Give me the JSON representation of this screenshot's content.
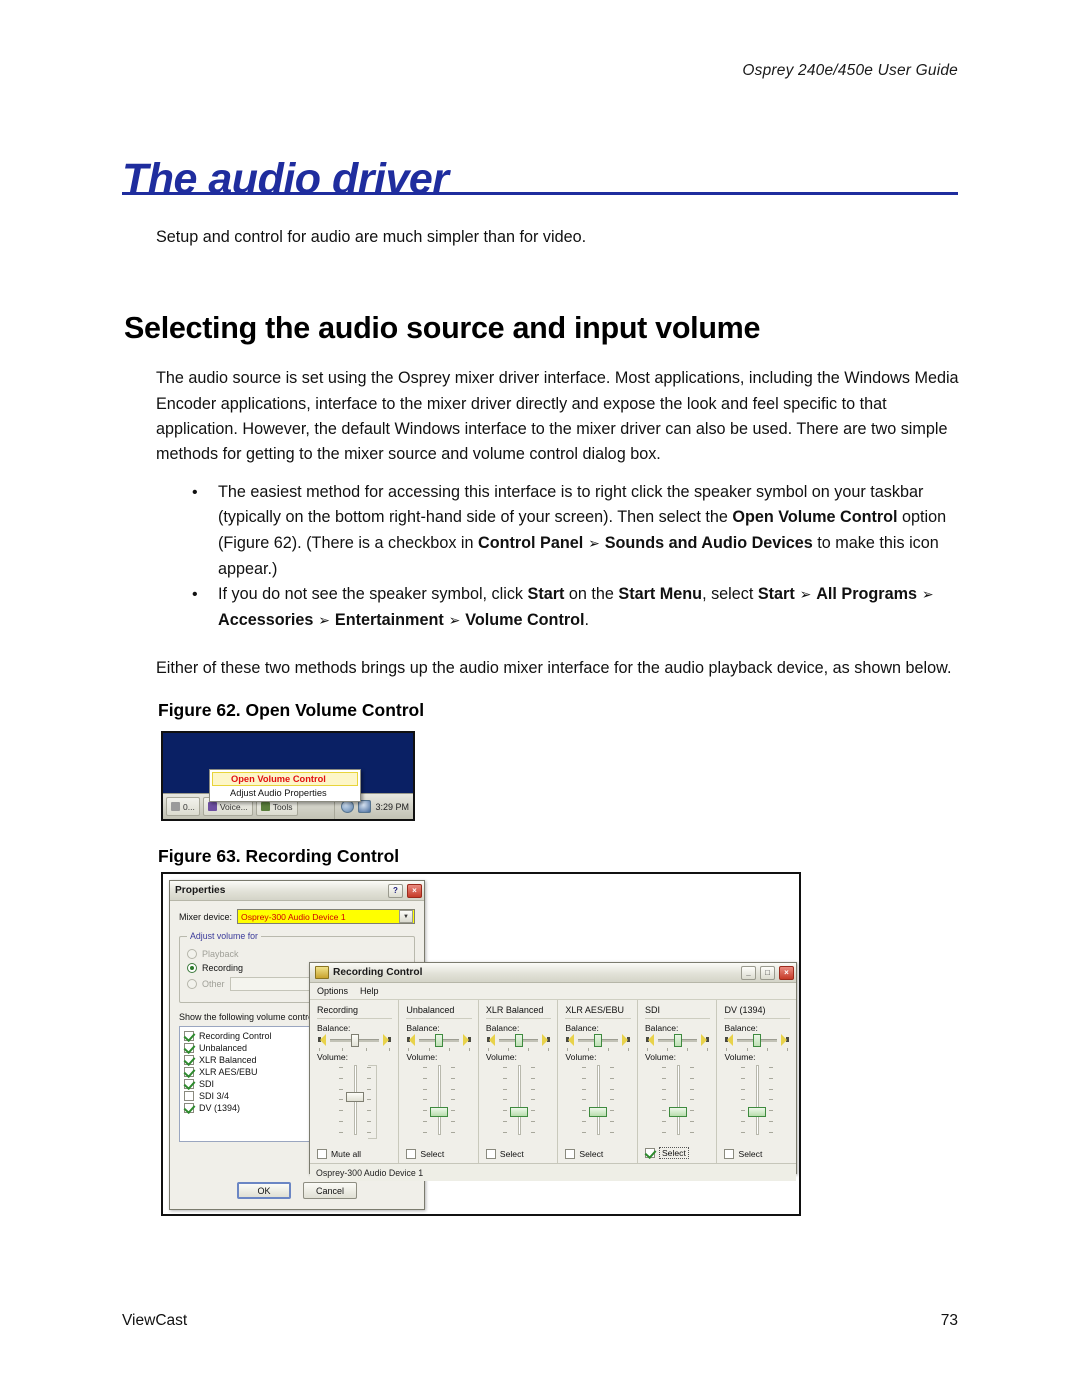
{
  "page": {
    "running_header": "Osprey 240e/450e User Guide",
    "chapter_title": "The audio driver",
    "intro_line": "Setup and control for audio are much simpler than for video.",
    "section_heading": "Selecting the audio source and input volume",
    "footer_left": "ViewCast",
    "footer_page_number": "73",
    "accent_color": "#1f2d9e"
  },
  "body": {
    "paragraph_intro": "The audio source is set using the Osprey mixer driver interface. Most applications, including the Windows Media Encoder applications, interface to the mixer driver directly and expose the look and feel specific to that application. However, the default Windows interface to the mixer driver can also be used. There are two simple methods for getting to the mixer source and volume control dialog box.",
    "paragraph_either": "Either of these two methods brings up the audio mixer interface for the audio playback device, as shown below.",
    "bullets": [
      {
        "marker": "•",
        "segments": [
          {
            "text": "The easiest method for accessing this interface is to right click the speaker symbol on your taskbar (typically on the bottom right-hand side of your screen). Then select the ",
            "bold": false
          },
          {
            "text": "Open Volume Control",
            "bold": true
          },
          {
            "text": " option (Figure 62). (There is a checkbox in ",
            "bold": false
          },
          {
            "text": "Control Panel",
            "bold": true
          },
          {
            "text": " ➢ ",
            "bold": true
          },
          {
            "text": "Sounds and Audio Devices",
            "bold": true
          },
          {
            "text": " to make this icon appear.)",
            "bold": false
          }
        ]
      },
      {
        "marker": "•",
        "segments": [
          {
            "text": "If you do not see the speaker symbol, click ",
            "bold": false
          },
          {
            "text": "Start",
            "bold": true
          },
          {
            "text": " on the ",
            "bold": false
          },
          {
            "text": "Start Menu",
            "bold": true
          },
          {
            "text": ", select ",
            "bold": false
          },
          {
            "text": "Start",
            "bold": true
          },
          {
            "text": " ➢ ",
            "bold": true
          },
          {
            "text": "All Programs",
            "bold": true
          },
          {
            "text": " ➢ ",
            "bold": true
          },
          {
            "text": "Accessories",
            "bold": true
          },
          {
            "text": " ➢ ",
            "bold": true
          },
          {
            "text": "Entertainment",
            "bold": true
          },
          {
            "text": " ➢ ",
            "bold": true
          },
          {
            "text": "Volume Control",
            "bold": true
          },
          {
            "text": ".",
            "bold": false
          }
        ]
      }
    ]
  },
  "figure62": {
    "caption": "Figure 62. Open Volume Control",
    "desktop_color": "#0a2064",
    "menu_items": [
      {
        "label": "Open Volume Control",
        "highlighted": true
      },
      {
        "label": "Adjust Audio Properties",
        "highlighted": false
      }
    ],
    "taskbar": {
      "buttons": [
        "0...",
        "Voice...",
        "Tools"
      ],
      "clock": "3:29 PM"
    }
  },
  "figure63": {
    "caption": "Figure 63. Recording Control",
    "properties_dialog": {
      "title": "Properties",
      "help_button": "?",
      "close_button": "×",
      "mixer_device_label": "Mixer device:",
      "mixer_device_value": "Osprey-300 Audio Device 1",
      "group_legend": "Adjust volume for",
      "radios": [
        {
          "label": "Playback",
          "selected": false,
          "disabled": true
        },
        {
          "label": "Recording",
          "selected": true,
          "disabled": false
        },
        {
          "label": "Other",
          "selected": false,
          "disabled": true
        }
      ],
      "show_controls_label": "Show the following volume controls:",
      "checkbox_list": [
        {
          "label": "Recording Control",
          "checked": true
        },
        {
          "label": "Unbalanced",
          "checked": true
        },
        {
          "label": "XLR Balanced",
          "checked": true
        },
        {
          "label": "XLR AES/EBU",
          "checked": true
        },
        {
          "label": "SDI",
          "checked": true
        },
        {
          "label": "SDI 3/4",
          "checked": false
        },
        {
          "label": "DV (1394)",
          "checked": true
        }
      ],
      "ok_button": "OK",
      "cancel_button": "Cancel"
    },
    "recording_control_window": {
      "title": "Recording Control",
      "minimize_button": "_",
      "maximize_button": "□",
      "close_button": "×",
      "menus": [
        "Options",
        "Help"
      ],
      "balance_label": "Balance:",
      "volume_label": "Volume:",
      "status_bar": "Osprey-300 Audio Device 1",
      "columns": [
        {
          "title": "Recording",
          "checkbox_label": "Mute all",
          "checked": false,
          "focused": false,
          "balance_center": true,
          "volume_level": 62,
          "thumb_style": "plain",
          "has_extra_track": true
        },
        {
          "title": "Unbalanced",
          "checkbox_label": "Select",
          "checked": false,
          "focused": false,
          "balance_center": true,
          "volume_level": 40,
          "thumb_style": "green",
          "has_extra_track": false
        },
        {
          "title": "XLR Balanced",
          "checkbox_label": "Select",
          "checked": false,
          "focused": false,
          "balance_center": true,
          "volume_level": 40,
          "thumb_style": "green",
          "has_extra_track": false
        },
        {
          "title": "XLR AES/EBU",
          "checkbox_label": "Select",
          "checked": false,
          "focused": false,
          "balance_center": true,
          "volume_level": 40,
          "thumb_style": "green",
          "has_extra_track": false
        },
        {
          "title": "SDI",
          "checkbox_label": "Select",
          "checked": true,
          "focused": true,
          "balance_center": true,
          "volume_level": 40,
          "thumb_style": "green",
          "has_extra_track": false
        },
        {
          "title": "DV (1394)",
          "checkbox_label": "Select",
          "checked": false,
          "focused": false,
          "balance_center": true,
          "volume_level": 40,
          "thumb_style": "green",
          "has_extra_track": false
        }
      ]
    }
  }
}
